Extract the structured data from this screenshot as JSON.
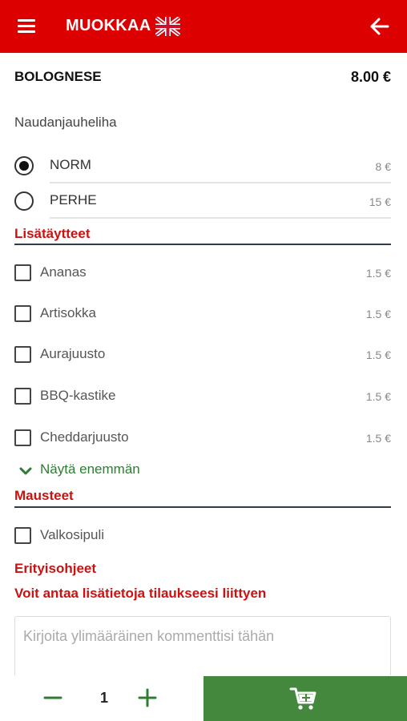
{
  "header": {
    "title": "MUOKKAA",
    "menu_icon": "hamburger-menu-icon",
    "flag_icon": "uk-flag-icon",
    "back_icon": "arrow-left-icon",
    "background_color": "#dd0000"
  },
  "product": {
    "name": "BOLOGNESE",
    "price": "8.00 €",
    "description": "Naudanjauheliha"
  },
  "sizes": [
    {
      "label": "NORM",
      "price": "8 €",
      "selected": true
    },
    {
      "label": "PERHE",
      "price": "15 €",
      "selected": false
    }
  ],
  "toppings_section": {
    "title": "Lisätäytteet",
    "items": [
      {
        "label": "Ananas",
        "price": "1.5 €",
        "checked": false
      },
      {
        "label": "Artisokka",
        "price": "1.5 €",
        "checked": false
      },
      {
        "label": "Aurajuusto",
        "price": "1.5 €",
        "checked": false
      },
      {
        "label": "BBQ-kastike",
        "price": "1.5 €",
        "checked": false
      },
      {
        "label": "Cheddarjuusto",
        "price": "1.5 €",
        "checked": false
      }
    ],
    "show_more": "Näytä enemmän"
  },
  "spices_section": {
    "title": "Mausteet",
    "items": [
      {
        "label": "Valkosipuli",
        "checked": false
      }
    ]
  },
  "special_instructions": {
    "title": "Erityisohjeet",
    "subtitle": "Voit antaa lisätietoja tilaukseesi liittyen",
    "placeholder": "Kirjoita ylimääräinen kommenttisi tähän"
  },
  "footer": {
    "quantity": "1",
    "minus_icon": "minus-icon",
    "plus_icon": "plus-icon",
    "cart_icon": "add-to-cart-icon",
    "cart_color": "#43883c"
  }
}
